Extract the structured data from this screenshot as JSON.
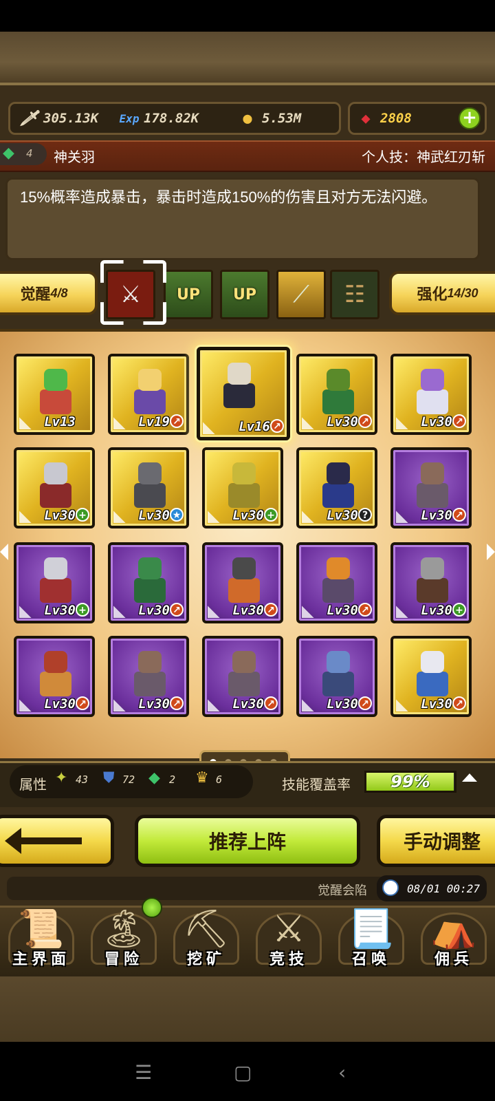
{
  "resources": {
    "attack": {
      "icon": "sword-icon",
      "value": "305.13K"
    },
    "exp": {
      "icon": "exp-icon",
      "value": "178.82K"
    },
    "gold": {
      "icon": "gold-coin-icon",
      "value": "5.53M"
    },
    "gems": {
      "icon": "ruby-icon",
      "value": "2808"
    },
    "add_label": "+"
  },
  "hero": {
    "rank_badge": "4",
    "name": "神关羽",
    "skill": "个人技：神武红刃斩",
    "description": "15%概率造成暴击，暴击时造成150%的伤害且对方无法闪避。"
  },
  "tabs": {
    "awaken_label": "觉醒",
    "awaken_count": "4/8",
    "enhance_label": "强化",
    "enhance_count": "14/30",
    "up_label": "UP",
    "icons": [
      "cracked-sword-icon",
      "up-crown-icon",
      "up-crown-icon",
      "golden-blade-icon",
      "scroll-icon"
    ]
  },
  "heroes": [
    {
      "lv": "Lv13",
      "frame": "gold",
      "badge": "",
      "head": "#4fb84a",
      "body": "#c84a3a"
    },
    {
      "lv": "Lv19",
      "frame": "gold",
      "badge": "up",
      "head": "#f2d070",
      "body": "#6a4aa8"
    },
    {
      "lv": "Lv16",
      "frame": "gold",
      "badge": "up",
      "head": "#e0d8c8",
      "body": "#2a2a3a",
      "selected": true
    },
    {
      "lv": "Lv30",
      "frame": "gold",
      "badge": "up",
      "head": "#5a8a2a",
      "body": "#2f7a3a"
    },
    {
      "lv": "Lv30",
      "frame": "gold",
      "badge": "up",
      "head": "#9a6ad0",
      "body": "#e0e0f0"
    },
    {
      "lv": "Lv30",
      "frame": "gold",
      "badge": "plus",
      "head": "#c8c8d0",
      "body": "#8a2a2a"
    },
    {
      "lv": "Lv30",
      "frame": "gold",
      "badge": "star",
      "head": "#6a6a70",
      "body": "#4a4a50"
    },
    {
      "lv": "Lv30",
      "frame": "gold",
      "badge": "plus",
      "head": "#c8b83a",
      "body": "#9a8a2a"
    },
    {
      "lv": "Lv30",
      "frame": "gold",
      "badge": "q",
      "head": "#2a2a4a",
      "body": "#2a3a8a"
    },
    {
      "lv": "Lv30",
      "frame": "purple",
      "badge": "up",
      "head": "#8a6a5a",
      "body": "#6a5a6a"
    },
    {
      "lv": "Lv30",
      "frame": "purple",
      "badge": "plus",
      "head": "#d0d0d8",
      "body": "#a03030"
    },
    {
      "lv": "Lv30",
      "frame": "purple",
      "badge": "up",
      "head": "#3a8a4a",
      "body": "#2a6a3a"
    },
    {
      "lv": "Lv30",
      "frame": "purple",
      "badge": "up",
      "head": "#4a4a4a",
      "body": "#d06a2a"
    },
    {
      "lv": "Lv30",
      "frame": "purple",
      "badge": "up",
      "head": "#e08a2a",
      "body": "#5a4a6a"
    },
    {
      "lv": "Lv30",
      "frame": "purple",
      "badge": "plus",
      "head": "#9a9a9a",
      "body": "#5a3a2a"
    },
    {
      "lv": "Lv30",
      "frame": "purple",
      "badge": "up",
      "head": "#b0402a",
      "body": "#d08a3a"
    },
    {
      "lv": "Lv30",
      "frame": "purple",
      "badge": "up",
      "head": "#8a6a5a",
      "body": "#6a5a6a"
    },
    {
      "lv": "Lv30",
      "frame": "purple",
      "badge": "up",
      "head": "#8a6a5a",
      "body": "#6a5a6a"
    },
    {
      "lv": "Lv30",
      "frame": "purple",
      "badge": "up",
      "head": "#6a8ac8",
      "body": "#3a4a7a"
    },
    {
      "lv": "Lv30",
      "frame": "gold",
      "badge": "up",
      "head": "#e8e8f0",
      "body": "#3a6ac0"
    }
  ],
  "pager": {
    "pages": 5,
    "current": 1
  },
  "stats": {
    "attr_label": "属性",
    "power_icon": "power-icon",
    "power": "43",
    "shield_icon": "shield-icon",
    "shield": "72",
    "gem_icon": "green-gem-icon",
    "gem": "2",
    "crown_icon": "crown-icon",
    "crown": "6",
    "coverage_label": "技能覆盖率",
    "coverage_value": "99%",
    "coverage_fraction": 0.99
  },
  "buttons": {
    "back_icon": "back-arrow-icon",
    "recommend": "推荐上阵",
    "manual": "手动调整"
  },
  "ticker": {
    "text": "觉醒会陷",
    "time": "08/01 00:27"
  },
  "menu": [
    {
      "label": "主界面",
      "icon": "map-scroll-icon"
    },
    {
      "label": "冒险",
      "icon": "island-icon"
    },
    {
      "label": "挖矿",
      "icon": "pickaxe-icon"
    },
    {
      "label": "竞技",
      "icon": "crossed-swords-icon"
    },
    {
      "label": "召唤",
      "icon": "summon-scroll-icon"
    },
    {
      "label": "佣兵",
      "icon": "tent-icon"
    }
  ]
}
